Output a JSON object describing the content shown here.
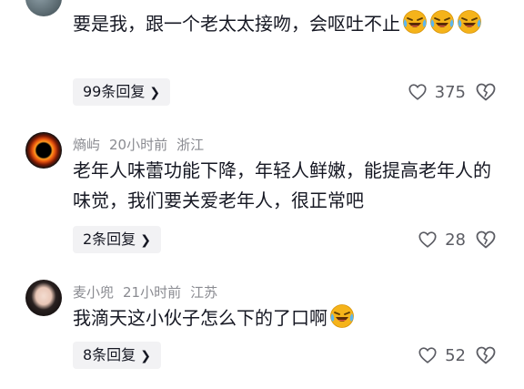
{
  "comments": [
    {
      "username": "",
      "time": "",
      "location": "",
      "text": "要是我，跟一个老太太接吻，会呕吐不止",
      "emoji": "laughing-crying-emoji",
      "reply_label": "99条回复",
      "likes": "375"
    },
    {
      "username": "熵屿",
      "time": "20小时前",
      "location": "浙江",
      "text": "老年人味蕾功能下降，年轻人鲜嫩，能提高老年人的味觉，我们要关爱老年人，很正常吧",
      "reply_label": "2条回复",
      "likes": "28"
    },
    {
      "username": "麦小兜",
      "time": "21小时前",
      "location": "江苏",
      "text": "我滴天这小伙子怎么下的了口啊",
      "emoji": "laughing-crying-emoji",
      "reply_label": "8条回复",
      "likes": "52"
    }
  ],
  "icons": {
    "like": "heart-outline-icon",
    "dislike": "broken-heart-icon",
    "reply_chevron": "chevron-right-icon"
  },
  "colors": {
    "text": "#161823",
    "meta": "#8a8b91",
    "reply_bg": "#f2f2f4",
    "emoji": "#f5b31a"
  }
}
